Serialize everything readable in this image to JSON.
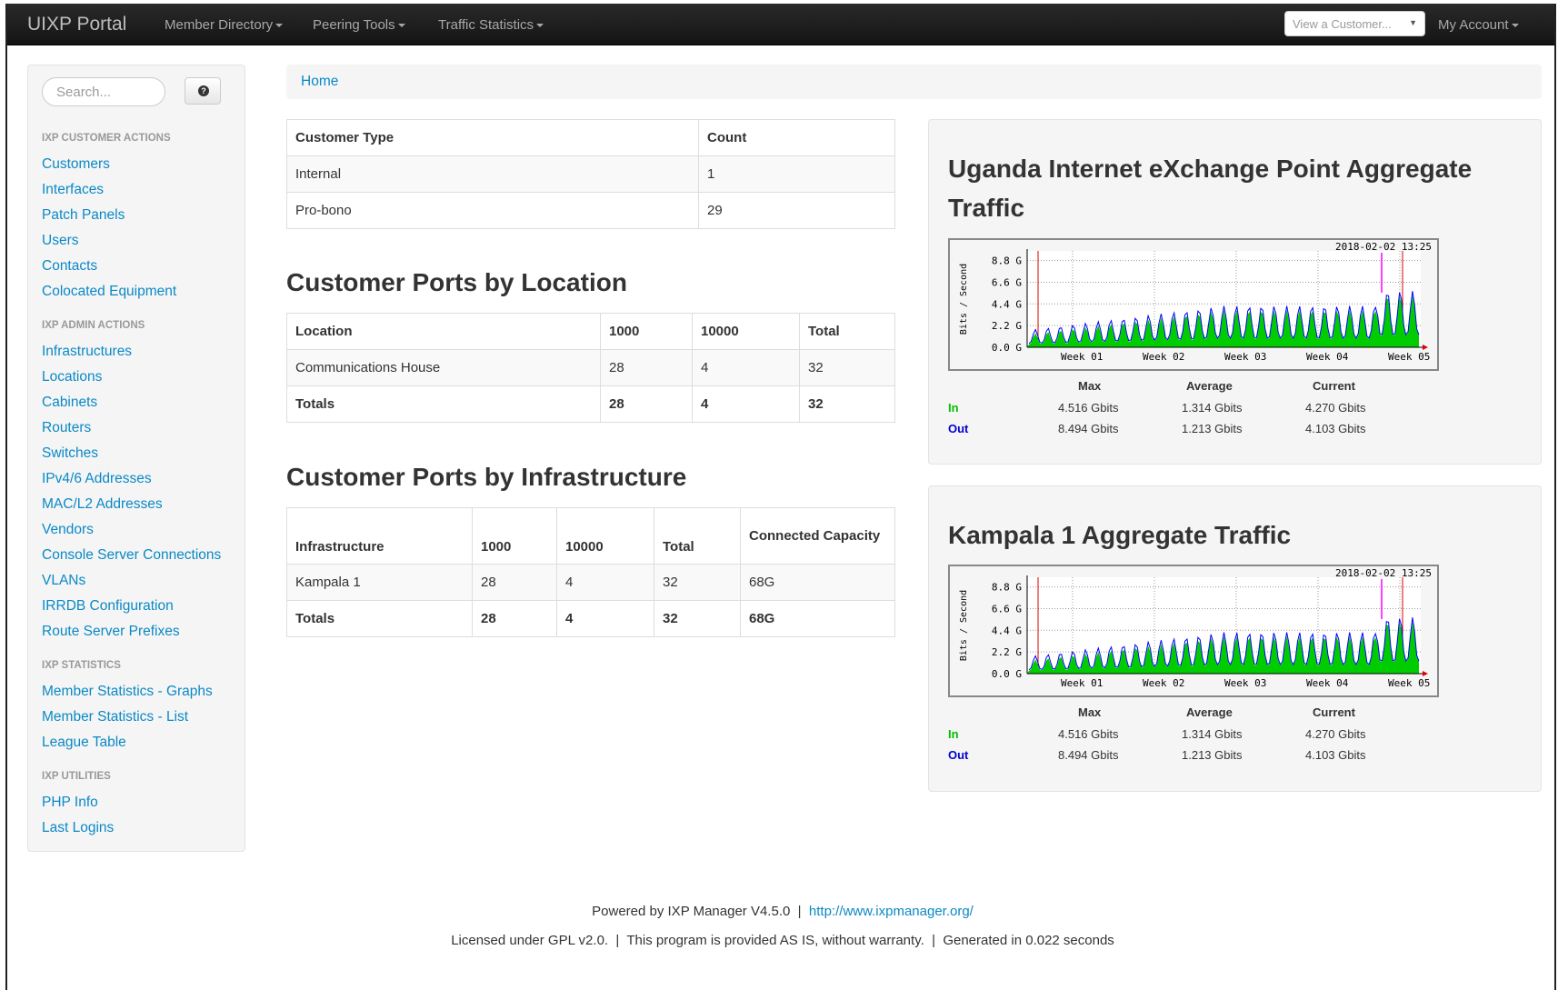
{
  "navbar": {
    "brand": "UIXP Portal",
    "menus": [
      "Member Directory",
      "Peering Tools",
      "Traffic Statistics"
    ],
    "customer_select": "View a Customer...",
    "account": "My Account"
  },
  "sidebar": {
    "search_placeholder": "Search...",
    "sections": [
      {
        "header": "IXP CUSTOMER ACTIONS",
        "items": [
          "Customers",
          "Interfaces",
          "Patch Panels",
          "Users",
          "Contacts",
          "Colocated Equipment"
        ]
      },
      {
        "header": "IXP ADMIN ACTIONS",
        "items": [
          "Infrastructures",
          "Locations",
          "Cabinets",
          "Routers",
          "Switches",
          "IPv4/6 Addresses",
          "MAC/L2 Addresses",
          "Vendors",
          "Console Server Connections",
          "VLANs",
          "IRRDB Configuration",
          "Route Server Prefixes"
        ]
      },
      {
        "header": "IXP STATISTICS",
        "items": [
          "Member Statistics - Graphs",
          "Member Statistics - List",
          "League Table"
        ]
      },
      {
        "header": "IXP UTILITIES",
        "items": [
          "PHP Info",
          "Last Logins"
        ]
      }
    ]
  },
  "breadcrumb": {
    "home": "Home"
  },
  "customer_types": {
    "headers": [
      "Customer Type",
      "Count"
    ],
    "rows": [
      [
        "Internal",
        "1"
      ],
      [
        "Pro-bono",
        "29"
      ]
    ]
  },
  "ports_by_location": {
    "title": "Customer Ports by Location",
    "headers": [
      "Location",
      "1000",
      "10000",
      "Total"
    ],
    "rows": [
      [
        "Communications House",
        "28",
        "4",
        "32"
      ]
    ],
    "totals": [
      "Totals",
      "28",
      "4",
      "32"
    ]
  },
  "ports_by_infrastructure": {
    "title": "Customer Ports by Infrastructure",
    "headers": [
      "Infrastructure",
      "1000",
      "10000",
      "Total",
      "Connected Capacity"
    ],
    "rows": [
      [
        "Kampala 1",
        "28",
        "4",
        "32",
        "68G"
      ]
    ],
    "totals": [
      "Totals",
      "28",
      "4",
      "32",
      "68G"
    ]
  },
  "graphs": [
    {
      "title": "Uganda Internet eXchange Point Aggregate Traffic",
      "timestamp": "2018-02-02 13:25",
      "y_axis_label": "Bits / Second",
      "y_ticks": [
        "0.0 G",
        "2.2 G",
        "4.4 G",
        "6.6 G",
        "8.8 G"
      ],
      "x_ticks": [
        "Week 01",
        "Week 02",
        "Week 03",
        "Week 04",
        "Week 05"
      ],
      "stat_headers": [
        "Max",
        "Average",
        "Current"
      ],
      "in_label": "In",
      "out_label": "Out",
      "in_values": [
        "4.516 Gbits",
        "1.314 Gbits",
        "4.270 Gbits"
      ],
      "out_values": [
        "8.494 Gbits",
        "1.213 Gbits",
        "4.103 Gbits"
      ]
    },
    {
      "title": "Kampala 1 Aggregate Traffic",
      "timestamp": "2018-02-02 13:25",
      "y_axis_label": "Bits / Second",
      "y_ticks": [
        "0.0 G",
        "2.2 G",
        "4.4 G",
        "6.6 G",
        "8.8 G"
      ],
      "x_ticks": [
        "Week 01",
        "Week 02",
        "Week 03",
        "Week 04",
        "Week 05"
      ],
      "stat_headers": [
        "Max",
        "Average",
        "Current"
      ],
      "in_label": "In",
      "out_label": "Out",
      "in_values": [
        "4.516 Gbits",
        "1.314 Gbits",
        "4.270 Gbits"
      ],
      "out_values": [
        "8.494 Gbits",
        "1.213 Gbits",
        "4.103 Gbits"
      ]
    }
  ],
  "footer": {
    "powered": "Powered by IXP Manager V4.5.0",
    "link": "http://www.ixpmanager.org/",
    "license": "Licensed under GPL v2.0.",
    "warranty": "This program is provided AS IS, without warranty.",
    "generated": "Generated in 0.022 seconds"
  },
  "colors": {
    "link": "#0b89c6",
    "navbar": "#1b1b1b",
    "in": "#00c000",
    "out": "#0000d0"
  }
}
